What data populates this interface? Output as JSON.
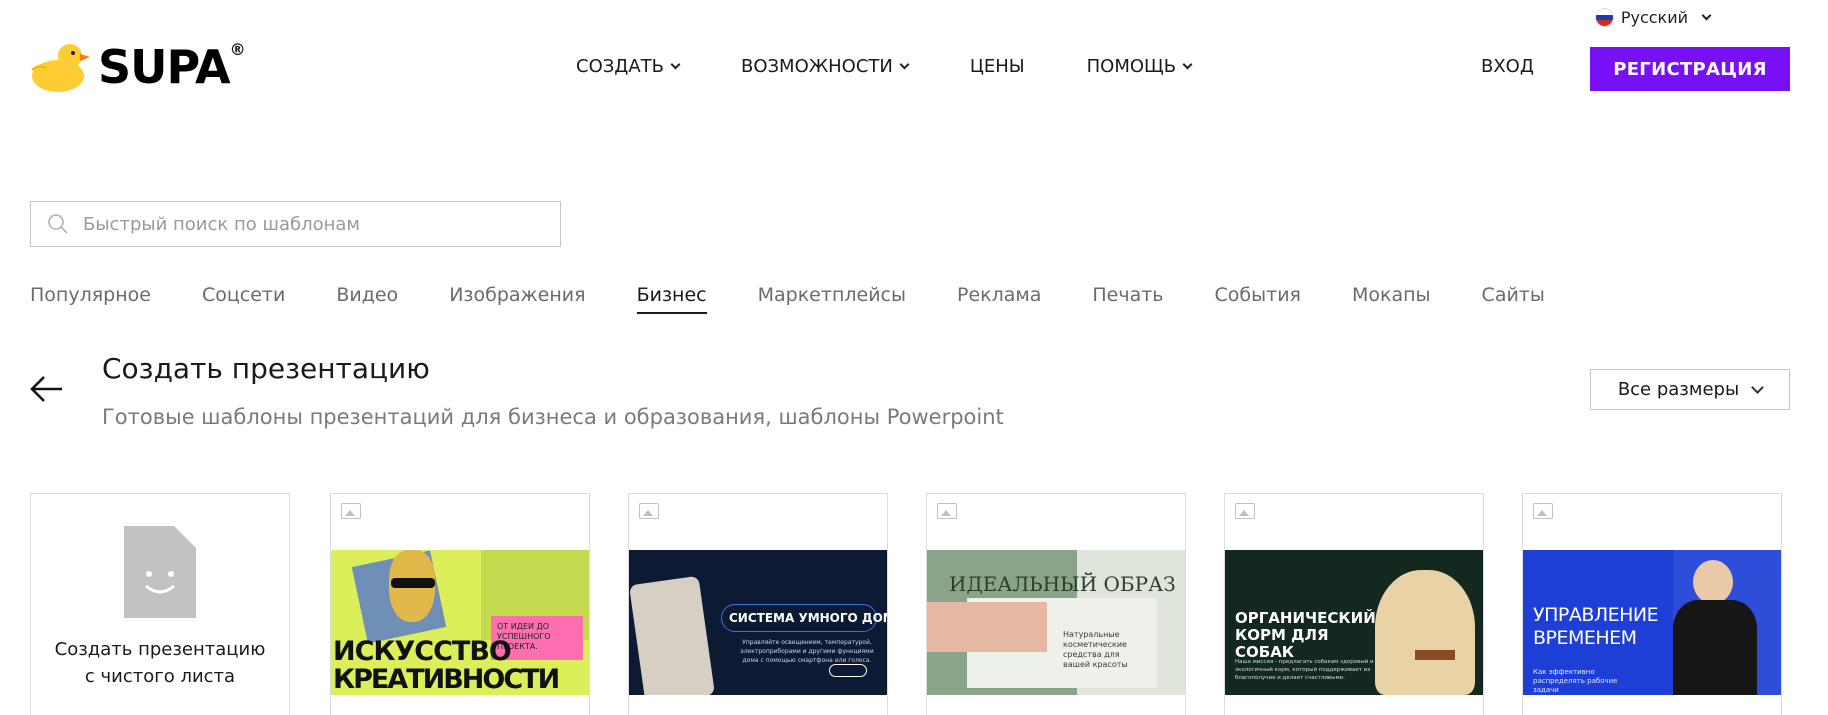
{
  "header": {
    "language": "Русский",
    "logo_text": "SUPA",
    "logo_mark": "®",
    "nav": [
      {
        "label": "СОЗДАТЬ",
        "dropdown": true
      },
      {
        "label": "ВОЗМОЖНОСТИ",
        "dropdown": true
      },
      {
        "label": "ЦЕНЫ",
        "dropdown": false
      },
      {
        "label": "ПОМОЩЬ",
        "dropdown": true
      }
    ],
    "login_label": "ВХОД",
    "register_label": "РЕГИСТРАЦИЯ",
    "accent_color": "#7810f5"
  },
  "search": {
    "placeholder": "Быстрый поиск по шаблонам"
  },
  "categories": {
    "items": [
      "Популярное",
      "Соцсети",
      "Видео",
      "Изображения",
      "Бизнес",
      "Маркетплейсы",
      "Реклама",
      "Печать",
      "События",
      "Мокапы",
      "Сайты"
    ],
    "active": "Бизнес"
  },
  "section": {
    "title": "Создать презентацию",
    "subtitle": "Готовые шаблоны презентаций для бизнеса и образования, шаблоны Powerpoint",
    "sizes_label": "Все размеры"
  },
  "cards": {
    "blank_label": "Создать презентацию с чистого листа",
    "templates": [
      {
        "line1": "ИСКУССТВО",
        "line2": "КРЕАТИВНОСТИ",
        "tag": "ОТ ИДЕИ ДО УСПЕШНОГО ПРОЕКТА."
      },
      {
        "title": "СИСТЕМА УМНОГО ДОМА",
        "text": "Управляйте освещением, температурой, электроприборами и другими функциями дома с помощью смартфона или голоса."
      },
      {
        "title": "ИДЕАЛЬНЫЙ ОБРАЗ",
        "text": "Натуральные косметические средства для вашей красоты"
      },
      {
        "title": "ОРГАНИЧЕСКИЙ КОРМ ДЛЯ СОБАК",
        "text": "Наша миссия - предлагать собакам здоровый и экологичный корм, который поддерживает их благополучие и делает счастливыми."
      },
      {
        "title": "УПРАВЛЕНИЕ ВРЕМЕНЕМ",
        "text": "Как эффективно распределять рабочие задачи"
      }
    ]
  }
}
